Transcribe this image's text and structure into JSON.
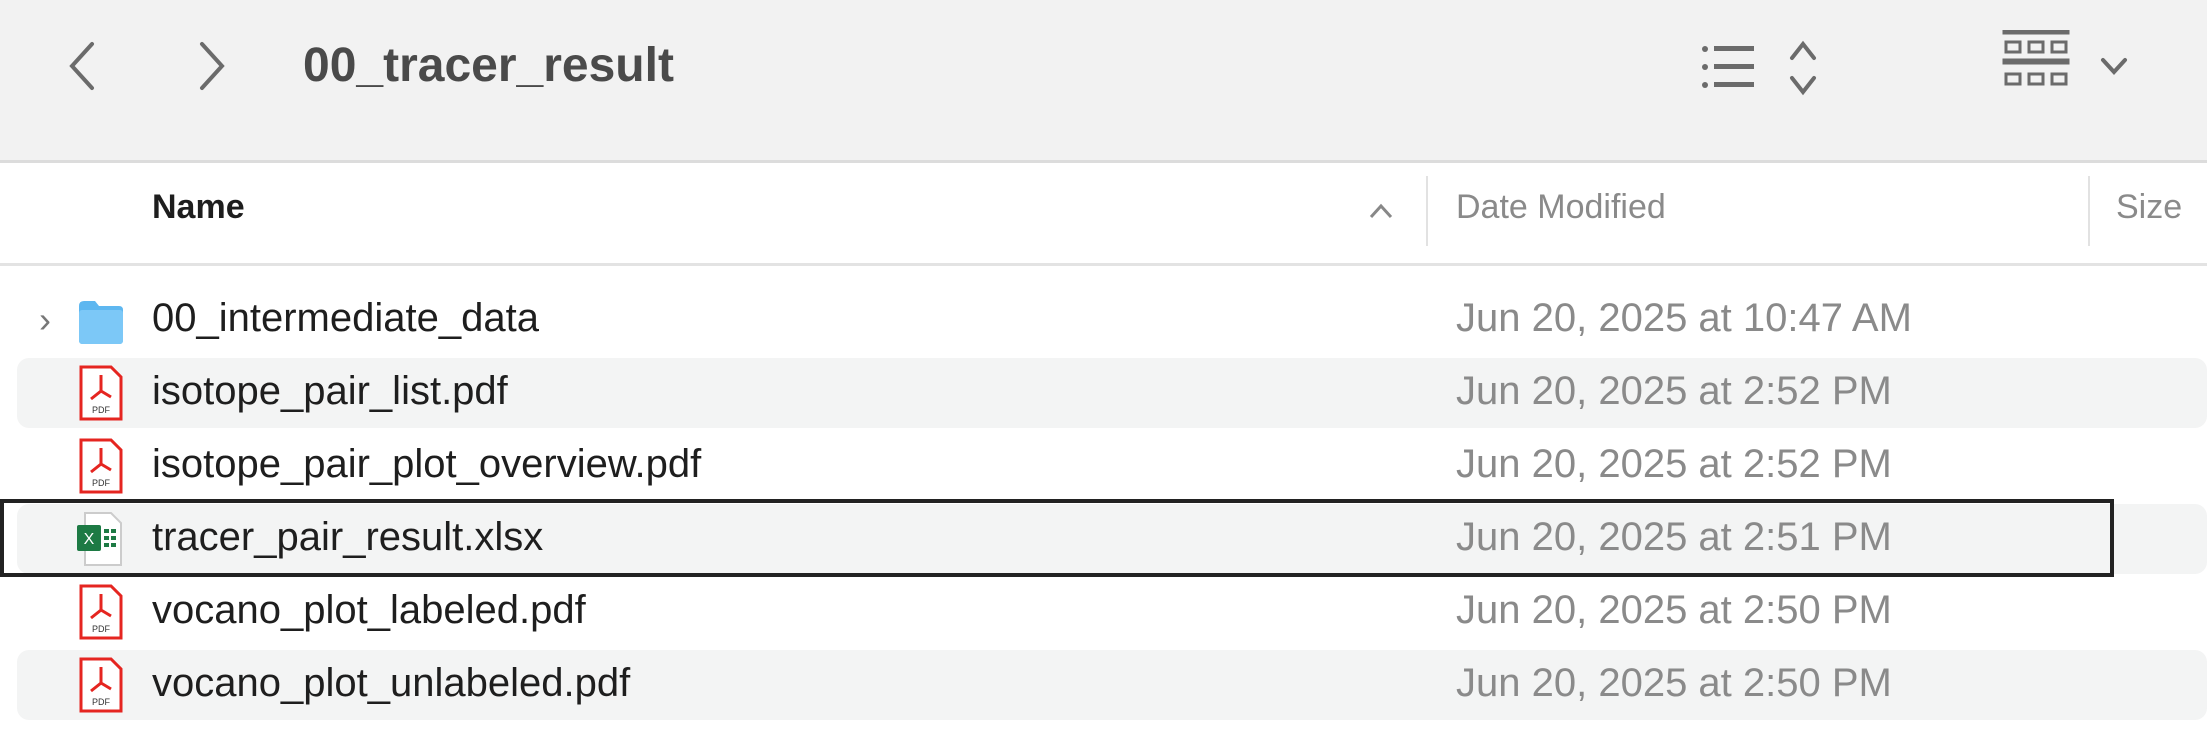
{
  "toolbar": {
    "title": "00_tracer_result",
    "back": "back",
    "forward": "forward",
    "list_view": "list-view",
    "group": "group-by"
  },
  "columns": {
    "name": "Name",
    "date": "Date Modified",
    "size": "Size"
  },
  "files": [
    {
      "name": "00_intermediate_data",
      "date": "Jun 20, 2025 at 10:47 AM",
      "type": "folder"
    },
    {
      "name": "isotope_pair_list.pdf",
      "date": "Jun 20, 2025 at 2:52 PM",
      "type": "pdf"
    },
    {
      "name": "isotope_pair_plot_overview.pdf",
      "date": "Jun 20, 2025 at 2:52 PM",
      "type": "pdf"
    },
    {
      "name": "tracer_pair_result.xlsx",
      "date": "Jun 20, 2025 at 2:51 PM",
      "type": "xlsx"
    },
    {
      "name": "vocano_plot_labeled.pdf",
      "date": "Jun 20, 2025 at 2:50 PM",
      "type": "pdf"
    },
    {
      "name": "vocano_plot_unlabeled.pdf",
      "date": "Jun 20, 2025 at 2:50 PM",
      "type": "pdf"
    }
  ],
  "colors": {
    "folder": "#5eb7f0",
    "pdf": "#e52520",
    "excel": "#1d7a44",
    "selection": "#222222"
  }
}
